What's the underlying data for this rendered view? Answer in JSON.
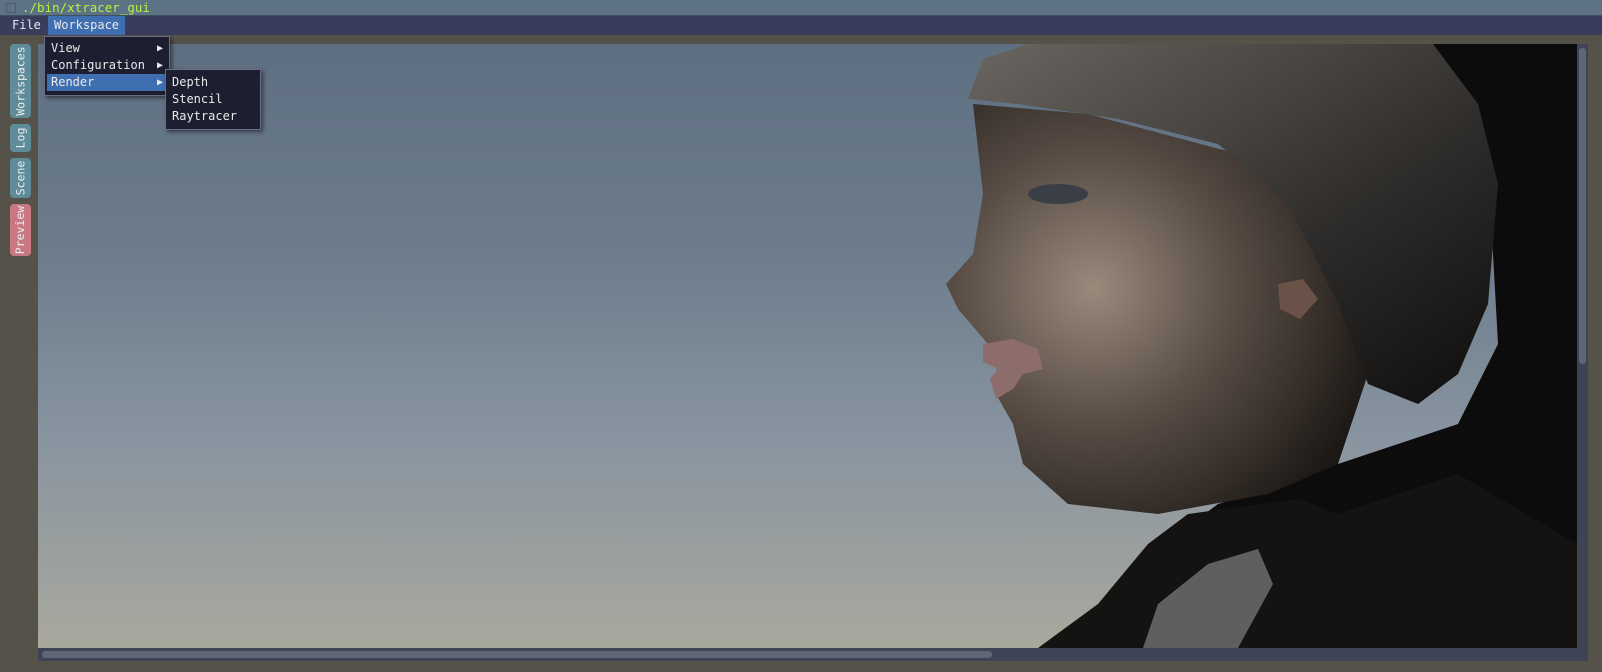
{
  "window": {
    "title": "./bin/xtracer_gui"
  },
  "menubar": {
    "file": "File",
    "workspace": "Workspace"
  },
  "workspace_menu": {
    "items": [
      {
        "label": "View",
        "arrow": "▶"
      },
      {
        "label": "Configuration",
        "arrow": "▶"
      },
      {
        "label": "Render",
        "arrow": "▶"
      }
    ]
  },
  "render_submenu": {
    "items": [
      "Depth",
      "Stencil",
      "Raytracer"
    ]
  },
  "side_tabs": [
    "Workspaces",
    "Log",
    "Scene",
    "Preview"
  ],
  "colors": {
    "accent": "#3f6fb0",
    "title_text": "#b5f53a",
    "preview_tab": "#c97882",
    "tab": "#5f8c98"
  }
}
